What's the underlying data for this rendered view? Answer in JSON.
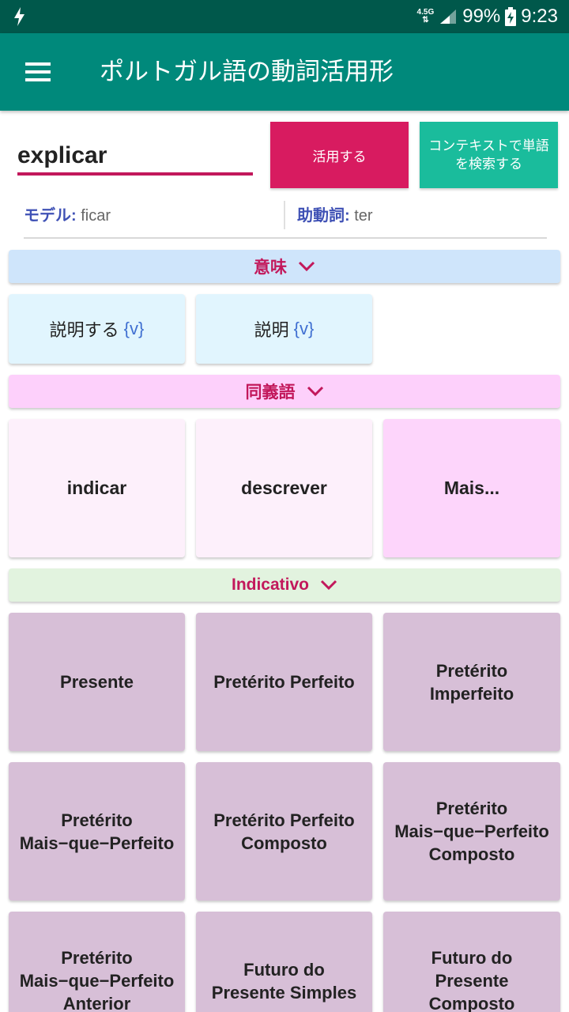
{
  "status_bar": {
    "network": "4.5G",
    "battery": "99%",
    "time": "9:23"
  },
  "app_bar": {
    "title": "ポルトガル語の動詞活用形"
  },
  "search": {
    "value": "explicar",
    "conjugate_label": "活用する",
    "context_label": "コンテキストで単語を検索する"
  },
  "info": {
    "model_label": "モデル:",
    "model_value": "ficar",
    "aux_label": "助動詞:",
    "aux_value": "ter"
  },
  "sections": {
    "meaning": "意味",
    "synonyms": "同義語",
    "indicative": "Indicativo"
  },
  "meanings": [
    {
      "text": "説明する",
      "tag": "{v}"
    },
    {
      "text": "説明",
      "tag": "{v}"
    }
  ],
  "synonyms": [
    "indicar",
    "descrever",
    "Mais..."
  ],
  "tenses": [
    "Presente",
    "Pretérito Perfeito",
    "Pretérito Imperfeito",
    "Pretérito Mais−que−Perfeito",
    "Pretérito Perfeito Composto",
    "Pretérito Mais−que−Perfeito Composto",
    "Pretérito Mais−que−Perfeito Anterior",
    "Futuro do Presente Simples",
    "Futuro do Presente Composto"
  ],
  "colors": {
    "status_bar": "#00584b",
    "app_bar": "#00897b",
    "accent": "#d81b60",
    "context_button": "#1abc9c",
    "meaning_header": "#cfe5fb",
    "synonym_header": "#fdd0fb",
    "indicative_header": "#e2f3df",
    "tense_card": "#d7bfd7"
  }
}
